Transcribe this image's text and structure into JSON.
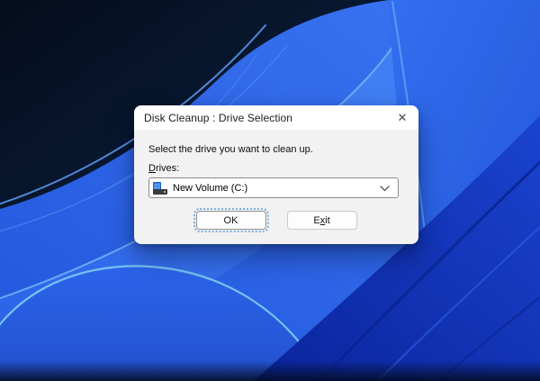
{
  "window": {
    "title": "Disk Cleanup : Drive Selection",
    "close_glyph": "✕"
  },
  "dialog": {
    "instruction": "Select the drive you want to clean up.",
    "drives_label": {
      "accel": "D",
      "rest": "rives:"
    },
    "drive_select": {
      "value": "New Volume (C:)",
      "icon": "hard-drive-icon",
      "chevron": "chevron-down-icon"
    },
    "buttons": {
      "ok": {
        "label": "OK",
        "focused": true
      },
      "exit": {
        "pre": "E",
        "accel": "x",
        "post": "it"
      }
    }
  },
  "colors": {
    "accent_blue": "#2f6bee",
    "focus_ring": "#79b1e6",
    "titlebar_bg": "#ffffff",
    "dialog_bg": "#f2f2f2",
    "wallpaper_dark_navy": "#081830",
    "wallpaper_bright_blue": "#3b76f2",
    "wallpaper_cyan_highlight": "#79c9f3",
    "wallpaper_dark_blue": "#0c2dae"
  }
}
